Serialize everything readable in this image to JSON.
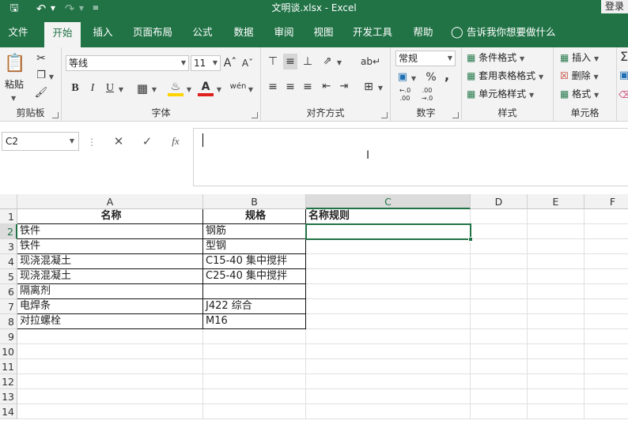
{
  "title": {
    "text": "文明谈.xlsx  -  Excel",
    "login": "登录"
  },
  "tabs": [
    "文件",
    "开始",
    "插入",
    "页面布局",
    "公式",
    "数据",
    "审阅",
    "视图",
    "开发工具",
    "帮助",
    "告诉我你想要做什么"
  ],
  "active_tab": "开始",
  "ribbon": {
    "clipboard": {
      "paste": "粘贴",
      "label": "剪贴板"
    },
    "font": {
      "name": "等线",
      "size": "11",
      "bold": "B",
      "italic": "I",
      "underline": "U",
      "label": "字体"
    },
    "align": {
      "label": "对齐方式"
    },
    "number": {
      "format": "常规",
      "percent": "%",
      "comma": ",",
      "label": "数字"
    },
    "styles": {
      "conditional": "条件格式",
      "table": "套用表格格式",
      "cell": "单元格样式",
      "label": "样式"
    },
    "cells": {
      "insert": "插入",
      "delete": "删除",
      "format": "格式",
      "label": "单元格"
    }
  },
  "formula": {
    "name_box": "C2",
    "value": ""
  },
  "columns": [
    "A",
    "B",
    "C",
    "D",
    "E",
    "F"
  ],
  "active_col": "C",
  "rows": [
    "1",
    "2",
    "3",
    "4",
    "5",
    "6",
    "7",
    "8",
    "9",
    "10",
    "11",
    "12",
    "13",
    "14"
  ],
  "active_row": "2",
  "cells": {
    "r1": [
      "名称",
      "规格",
      "名称规则"
    ],
    "r2": [
      "铁件",
      "钢筋",
      ""
    ],
    "r3": [
      "铁件",
      "型钢",
      ""
    ],
    "r4": [
      "现浇混凝土",
      "C15-40 集中搅拌",
      ""
    ],
    "r5": [
      "现浇混凝土",
      "C25-40 集中搅拌",
      ""
    ],
    "r6": [
      "隔离剂",
      "",
      ""
    ],
    "r7": [
      "电焊条",
      "J422 综合",
      ""
    ],
    "r8": [
      "对拉螺栓",
      "M16",
      ""
    ]
  },
  "colors": {
    "excel_green": "#217346",
    "font_yellow": "#ffd400",
    "font_red": "#e01f1f"
  }
}
